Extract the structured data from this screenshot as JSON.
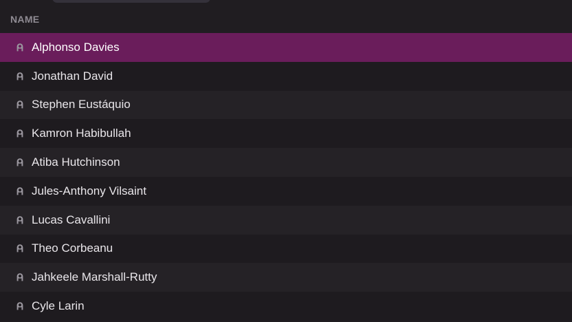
{
  "header": {
    "column_name": "NAME"
  },
  "players": [
    {
      "name": "Alphonso Davies",
      "selected": true,
      "icon": "person-icon"
    },
    {
      "name": "Jonathan David",
      "selected": false,
      "icon": "person-icon"
    },
    {
      "name": "Stephen Eustáquio",
      "selected": false,
      "icon": "person-icon"
    },
    {
      "name": "Kamron Habibullah",
      "selected": false,
      "icon": "person-icon"
    },
    {
      "name": "Atiba Hutchinson",
      "selected": false,
      "icon": "person-icon"
    },
    {
      "name": "Jules-Anthony Vilsaint",
      "selected": false,
      "icon": "person-icon"
    },
    {
      "name": "Lucas Cavallini",
      "selected": false,
      "icon": "person-icon"
    },
    {
      "name": "Theo Corbeanu",
      "selected": false,
      "icon": "person-icon"
    },
    {
      "name": "Jahkeele Marshall-Rutty",
      "selected": false,
      "icon": "person-icon"
    },
    {
      "name": "Cyle Larin",
      "selected": false,
      "icon": "person-icon"
    }
  ],
  "colors": {
    "background": "#201d21",
    "selected_row": "#6a1d5b",
    "header_text": "#8f8b93",
    "row_text": "#e9e6ea",
    "icon": "#9a969e"
  }
}
